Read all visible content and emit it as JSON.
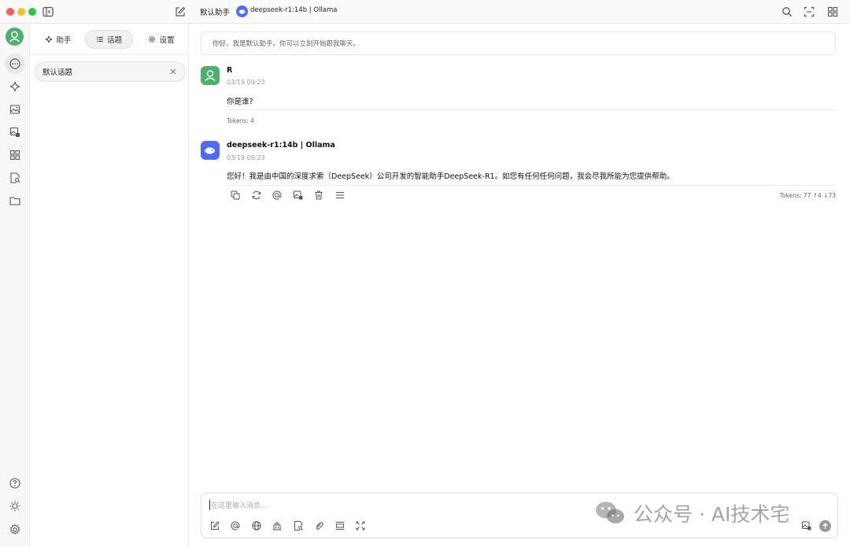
{
  "titlebar": {
    "assistant_name": "默认助手",
    "model_label": "deepseek-r1:14b | Ollama"
  },
  "sidebar": {
    "tabs": [
      {
        "label": "助手",
        "icon": "sparkle-icon",
        "active": false
      },
      {
        "label": "话题",
        "icon": "list-icon",
        "active": true
      },
      {
        "label": "设置",
        "icon": "gear-icon",
        "active": false
      }
    ],
    "topics": [
      {
        "label": "默认话题"
      }
    ]
  },
  "rail": {
    "items": [
      "avatar",
      "chat-icon",
      "sparkle-icon",
      "image-icon",
      "image-translate-icon",
      "apps-icon",
      "file-search-icon",
      "folder-icon"
    ],
    "bottom": [
      "help-icon",
      "sun-icon",
      "gear-icon"
    ]
  },
  "chat": {
    "notice": "你好，我是默认助手。你可以立刻开始跟我聊天。",
    "messages": [
      {
        "sender": "R",
        "time": "03/19 09:23",
        "text": "你是谁?",
        "tokens": "Tokens: 4"
      },
      {
        "sender": "deepseek-r1:14b | Ollama",
        "time": "03/19 09:23",
        "text": "您好！我是由中国的深度求索（DeepSeek）公司开发的智能助手DeepSeek-R1。如您有任何任何问题，我会尽我所能为您提供帮助。",
        "tokens": "Tokens: 77 ↑4 ↓73"
      }
    ]
  },
  "input": {
    "placeholder": "在这里输入消息..."
  },
  "watermark": {
    "text": "公众号 · AI技术宅"
  },
  "colors": {
    "user_avatar": "#4caf6d",
    "model_logo": "#4d6bfe",
    "traffic_red": "#fe5f57",
    "traffic_yellow": "#febc2e",
    "traffic_green": "#28c840"
  }
}
